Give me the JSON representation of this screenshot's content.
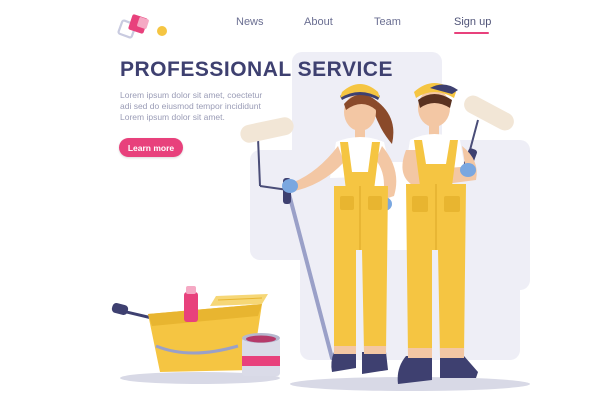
{
  "nav": {
    "items": [
      {
        "label": "News"
      },
      {
        "label": "About"
      },
      {
        "label": "Team"
      },
      {
        "label": "Sign up"
      }
    ]
  },
  "hero": {
    "title": "PROFESSIONAL SERVICE",
    "body_lines": [
      "Lorem ipsum dolor sit amet, coectetur",
      "adi sed do eiusmod tempor incididunt",
      "Lorem ipsum dolor sit amet."
    ],
    "cta_label": "Learn more"
  },
  "colors": {
    "accent": "#e8417c",
    "title": "#3e4070",
    "nav_text": "#6b6f92",
    "body_text": "#9a9cb6",
    "overall_yellow": "#f5c542",
    "backdrop": "#eeeef6"
  },
  "icons": {
    "logo": "overlapping-squares-logo"
  }
}
